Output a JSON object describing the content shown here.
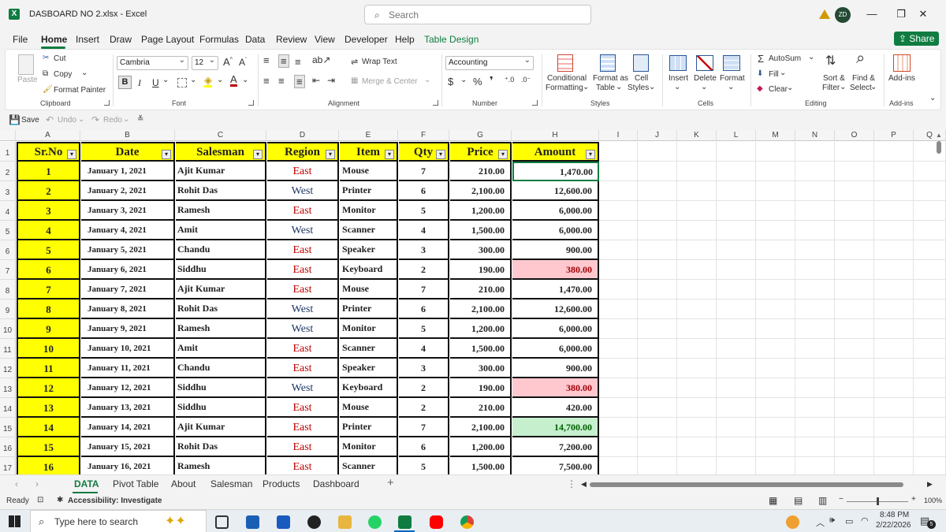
{
  "window": {
    "title": "DASBOARD NO 2.xlsx  -  Excel",
    "search_placeholder": "Search",
    "user_initials": "ZD"
  },
  "menu": [
    "File",
    "Home",
    "Insert",
    "Draw",
    "Page Layout",
    "Formulas",
    "Data",
    "Review",
    "View",
    "Developer",
    "Help",
    "Table Design"
  ],
  "share_label": "Share",
  "ribbon": {
    "clipboard": {
      "paste": "Paste",
      "cut": "Cut",
      "copy": "Copy",
      "format_painter": "Format Painter",
      "label": "Clipboard"
    },
    "font": {
      "name": "Cambria",
      "size": "12",
      "label": "Font"
    },
    "alignment": {
      "wrap": "Wrap Text",
      "merge": "Merge & Center",
      "label": "Alignment"
    },
    "number": {
      "format": "Accounting",
      "label": "Number"
    },
    "styles": {
      "conditional": "Conditional",
      "conditional2": "Formatting",
      "format_as": "Format as",
      "format_as2": "Table",
      "cell": "Cell",
      "cell2": "Styles",
      "label": "Styles"
    },
    "cells": {
      "insert": "Insert",
      "delete": "Delete",
      "format": "Format",
      "label": "Cells"
    },
    "editing": {
      "autosum": "AutoSum",
      "fill": "Fill",
      "clear": "Clear",
      "sort": "Sort &",
      "sort2": "Filter",
      "find": "Find &",
      "find2": "Select",
      "label": "Editing"
    },
    "addins": {
      "label": "Add-ins",
      "title": "Add-ins"
    }
  },
  "qat": {
    "save": "Save",
    "undo": "Undo",
    "redo": "Redo"
  },
  "columns": [
    "A",
    "B",
    "C",
    "D",
    "E",
    "F",
    "G",
    "H",
    "I",
    "J",
    "K",
    "L",
    "M",
    "N",
    "O",
    "P",
    "Q"
  ],
  "headers": [
    "Sr.No",
    "Date",
    "Salesman",
    "Region",
    "Item",
    "Qty",
    "Price",
    "Amount"
  ],
  "rows": [
    [
      "1",
      "January 1, 2021",
      "Ajit Kumar",
      "East",
      "Mouse",
      "7",
      "210.00",
      "1,470.00"
    ],
    [
      "2",
      "January 2, 2021",
      "Rohit Das",
      "West",
      "Printer",
      "6",
      "2,100.00",
      "12,600.00"
    ],
    [
      "3",
      "January 3, 2021",
      "Ramesh",
      "East",
      "Monitor",
      "5",
      "1,200.00",
      "6,000.00"
    ],
    [
      "4",
      "January 4, 2021",
      "Amit",
      "West",
      "Scanner",
      "4",
      "1,500.00",
      "6,000.00"
    ],
    [
      "5",
      "January 5, 2021",
      "Chandu",
      "East",
      "Speaker",
      "3",
      "300.00",
      "900.00"
    ],
    [
      "6",
      "January 6, 2021",
      "Siddhu",
      "East",
      "Keyboard",
      "2",
      "190.00",
      "380.00"
    ],
    [
      "7",
      "January 7, 2021",
      "Ajit Kumar",
      "East",
      "Mouse",
      "7",
      "210.00",
      "1,470.00"
    ],
    [
      "8",
      "January 8, 2021",
      "Rohit Das",
      "West",
      "Printer",
      "6",
      "2,100.00",
      "12,600.00"
    ],
    [
      "9",
      "January 9, 2021",
      "Ramesh",
      "West",
      "Monitor",
      "5",
      "1,200.00",
      "6,000.00"
    ],
    [
      "10",
      "January 10, 2021",
      "Amit",
      "East",
      "Scanner",
      "4",
      "1,500.00",
      "6,000.00"
    ],
    [
      "11",
      "January 11, 2021",
      "Chandu",
      "East",
      "Speaker",
      "3",
      "300.00",
      "900.00"
    ],
    [
      "12",
      "January 12, 2021",
      "Siddhu",
      "West",
      "Keyboard",
      "2",
      "190.00",
      "380.00"
    ],
    [
      "13",
      "January 13, 2021",
      "Siddhu",
      "East",
      "Mouse",
      "2",
      "210.00",
      "420.00"
    ],
    [
      "14",
      "January 14, 2021",
      "Ajit Kumar",
      "East",
      "Printer",
      "7",
      "2,100.00",
      "14,700.00"
    ],
    [
      "15",
      "January 15, 2021",
      "Rohit Das",
      "East",
      "Monitor",
      "6",
      "1,200.00",
      "7,200.00"
    ],
    [
      "16",
      "January 16, 2021",
      "Ramesh",
      "East",
      "Scanner",
      "5",
      "1,500.00",
      "7,500.00"
    ]
  ],
  "row_numbers": [
    "1",
    "2",
    "3",
    "4",
    "5",
    "6",
    "7",
    "8",
    "9",
    "10",
    "11",
    "12",
    "13",
    "14",
    "15",
    "16",
    "17"
  ],
  "colors": {
    "east": "#c00000",
    "west": "#1f3864",
    "low": "#ffc7ce",
    "low_text": "#9c0006",
    "high": "#c6efce",
    "high_text": "#006100",
    "header": "#ffff00",
    "excel_green": "#107c41"
  },
  "sheet_tabs": [
    "DATA",
    "Pivot Table",
    "About",
    "Salesman",
    "Products",
    "Dashboard"
  ],
  "status": {
    "ready": "Ready",
    "accessibility": "Accessibility: Investigate",
    "zoom": "100%"
  },
  "taskbar": {
    "search_placeholder": "Type here to search",
    "time": "8:48 PM",
    "date": "2/22/2026",
    "notifications": "5"
  }
}
